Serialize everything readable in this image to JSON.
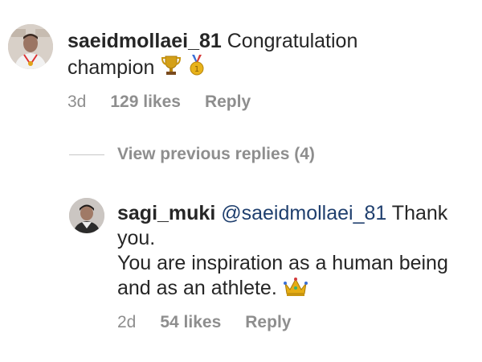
{
  "comments": [
    {
      "username": "saeidmollaei_81",
      "text": "Congratulation champion",
      "emoji": [
        "trophy-icon",
        "medal-icon"
      ],
      "time": "3d",
      "likes": "129 likes",
      "reply": "Reply"
    },
    {
      "username": "sagi_muki",
      "mention": "@saeidmollaei_81",
      "text_line1": "Thank you.",
      "text_line2": "You are inspiration as a human being and as an athlete.",
      "emoji": [
        "crown-icon"
      ],
      "time": "2d",
      "likes": "54 likes",
      "reply": "Reply"
    }
  ],
  "view_replies": {
    "label": "View previous replies (4)"
  },
  "colors": {
    "text": "#262626",
    "meta": "#8e8e8e",
    "mention": "#1f3f6e",
    "divider": "#c7c7c7"
  }
}
